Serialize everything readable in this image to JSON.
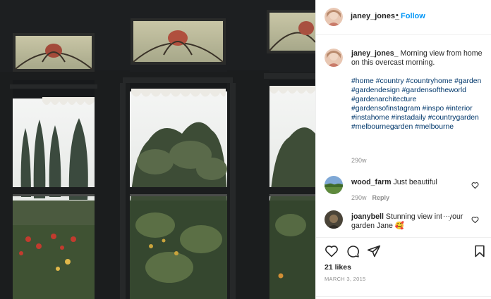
{
  "post": {
    "author": "janey_jones_",
    "follow_dot": "•",
    "follow_label": "Follow",
    "caption_user": "janey_jones_",
    "caption_text": "Morning view from home on this overcast morning.",
    "hashtags": [
      "#home",
      "#country",
      "#countryhome",
      "#garden",
      "#gardendesign",
      "#gardensoftheworld",
      "#gardenarchitecture",
      "#gardensofinstagram",
      "#inspo",
      "#interior",
      "#instahome",
      "#instadaily",
      "#countrygarden",
      "#melbournegarden",
      "#melbourne"
    ],
    "caption_age": "290w",
    "comments": [
      {
        "user": "wood_farm",
        "text": "Just beautiful",
        "age": "290w",
        "reply_label": "Reply"
      },
      {
        "user": "joanybell",
        "text": "Stunning view into your garden Jane 🥰",
        "more": "···"
      }
    ],
    "likes": "21 likes",
    "date": "MARCH 3, 2015"
  },
  "photo": {
    "alt": "Window view of a garden with cypress trees on an overcast morning"
  },
  "icons": [
    "heart-icon",
    "comment-icon",
    "share-icon",
    "bookmark-icon",
    "heart-outline-icon"
  ],
  "colors": {
    "follow": "#0095f6",
    "hashtag": "#00376b",
    "muted": "#8e8e8e",
    "text": "#262626"
  }
}
